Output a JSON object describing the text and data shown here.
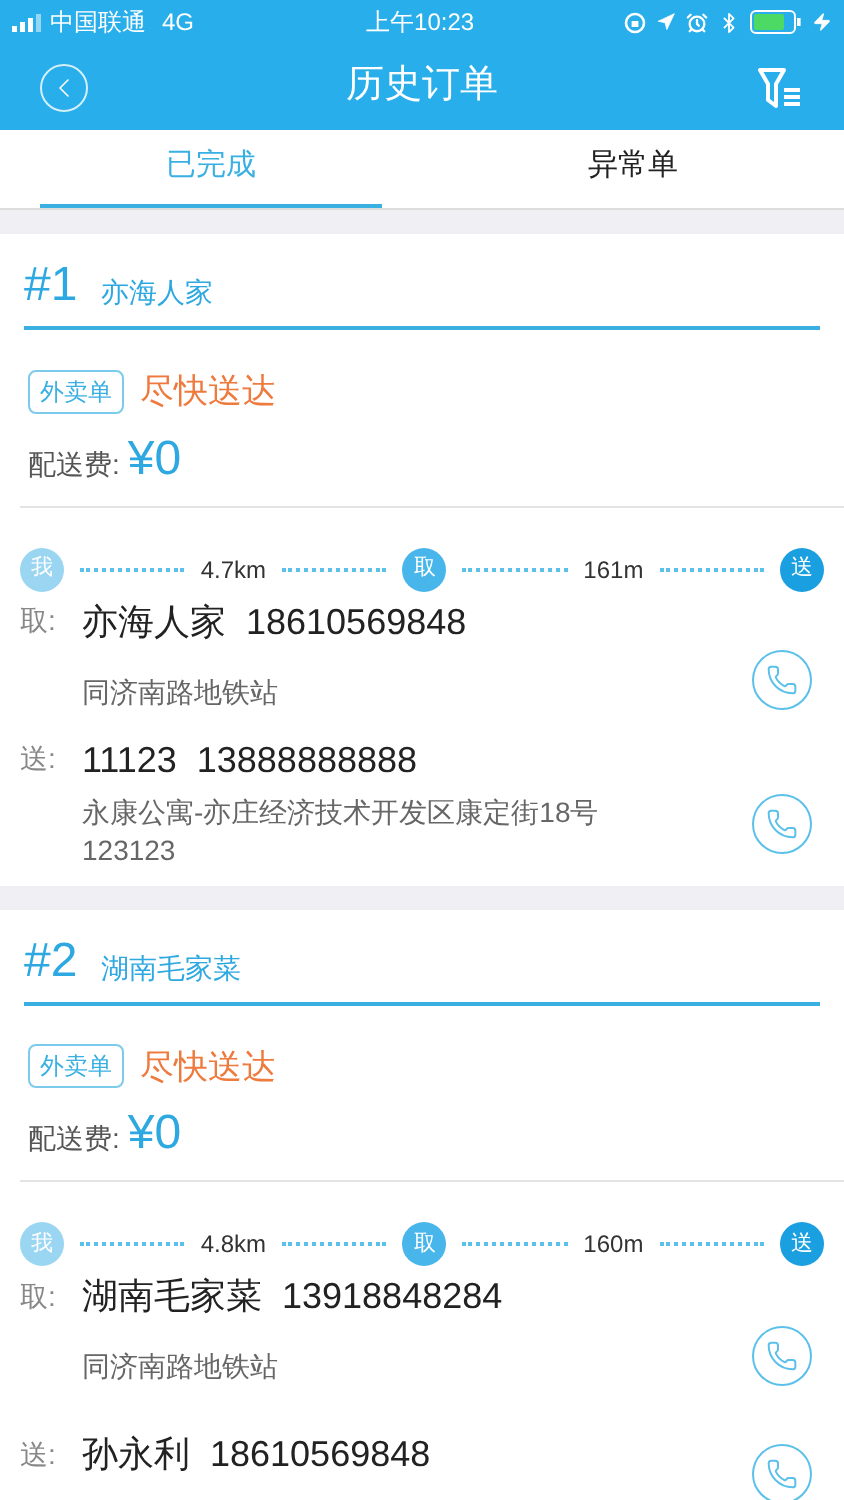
{
  "status_bar": {
    "carrier": "中国联通",
    "network": "4G",
    "time": "上午10:23"
  },
  "nav": {
    "title": "历史订单"
  },
  "tabs": [
    {
      "label": "已完成",
      "selected": true
    },
    {
      "label": "异常单",
      "selected": false
    }
  ],
  "orders": [
    {
      "number": "#1",
      "shop": "亦海人家",
      "tag": "外卖单",
      "urgency": "尽快送达",
      "fee_label": "配送费:",
      "fee": "¥0",
      "route": {
        "me": "我",
        "pickup": "取",
        "deliver": "送",
        "leg1": "4.7km",
        "leg2": "161m"
      },
      "pickup": {
        "label": "取:",
        "contact": "亦海人家  18610569848",
        "address": "同济南路地铁站"
      },
      "delivery": {
        "label": "送:",
        "contact": "11123  13888888888",
        "address": "永康公寓-亦庄经济技术开发区康定街18号",
        "address_extra": "123123"
      }
    },
    {
      "number": "#2",
      "shop": "湖南毛家菜",
      "tag": "外卖单",
      "urgency": "尽快送达",
      "fee_label": "配送费:",
      "fee": "¥0",
      "route": {
        "me": "我",
        "pickup": "取",
        "deliver": "送",
        "leg1": "4.8km",
        "leg2": "160m"
      },
      "pickup": {
        "label": "取:",
        "contact": "湖南毛家菜  13918848284",
        "address": "同济南路地铁站"
      },
      "delivery": {
        "label": "送:",
        "contact": "孙永利  18610569848"
      }
    }
  ]
}
